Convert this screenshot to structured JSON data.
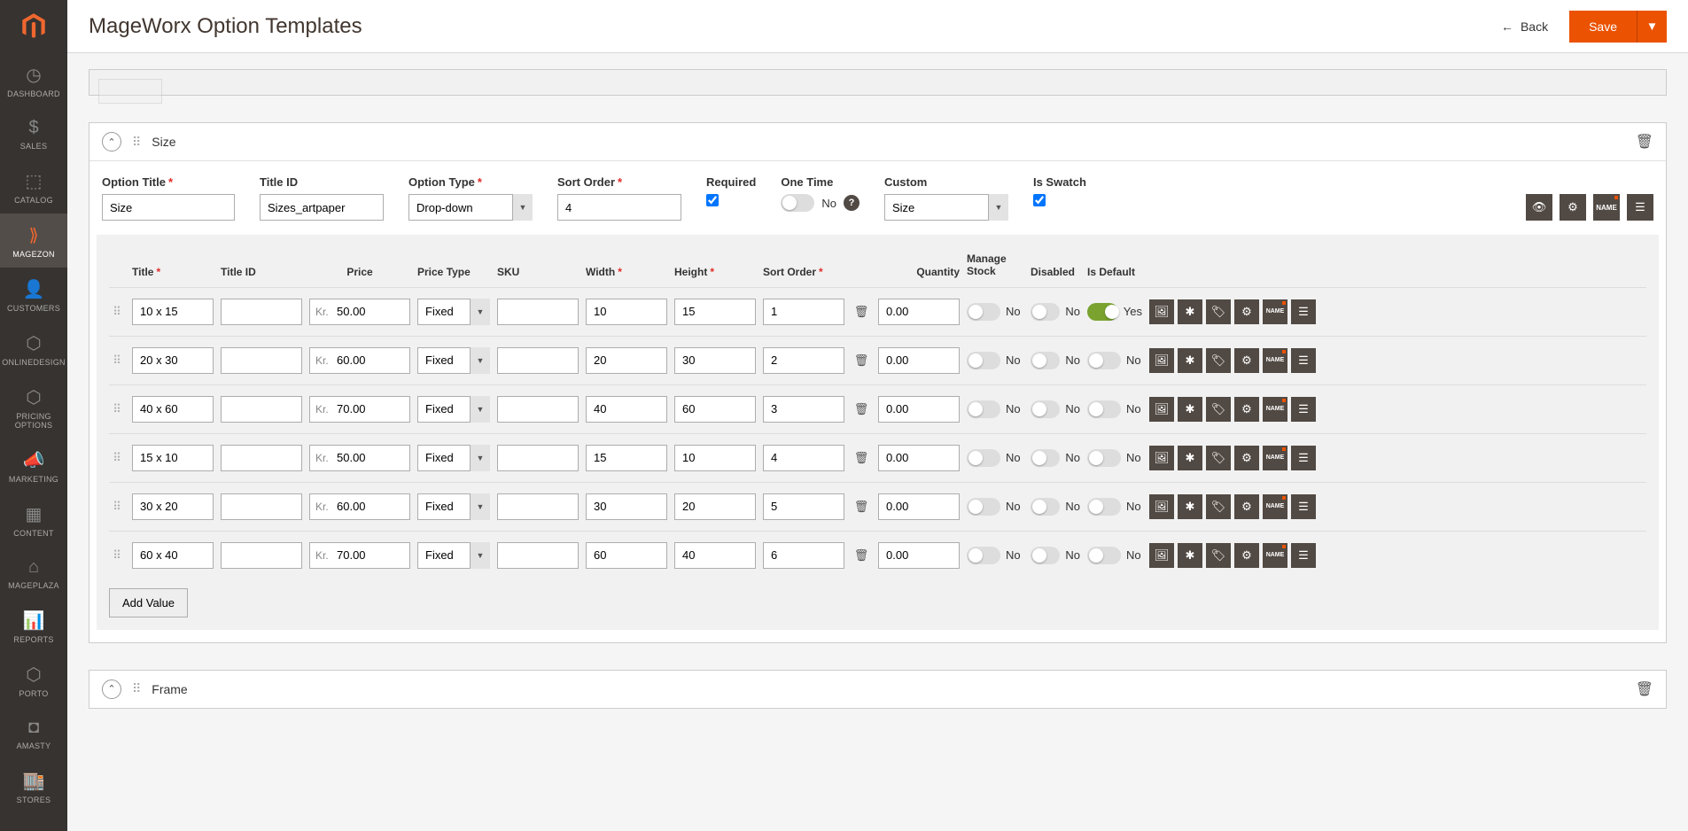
{
  "sidebar": {
    "items": [
      {
        "label": "Dashboard",
        "icon": "dashboard"
      },
      {
        "label": "Sales",
        "icon": "dollar"
      },
      {
        "label": "Catalog",
        "icon": "box"
      },
      {
        "label": "Magezon",
        "icon": "magezon"
      },
      {
        "label": "Customers",
        "icon": "person"
      },
      {
        "label": "OnlineDesign",
        "icon": "hex"
      },
      {
        "label": "Pricing Options",
        "icon": "hex"
      },
      {
        "label": "Marketing",
        "icon": "megaphone"
      },
      {
        "label": "Content",
        "icon": "layout"
      },
      {
        "label": "Mageplaza",
        "icon": "roof"
      },
      {
        "label": "Reports",
        "icon": "bars"
      },
      {
        "label": "Porto",
        "icon": "hex"
      },
      {
        "label": "Amasty",
        "icon": "amasty"
      },
      {
        "label": "Stores",
        "icon": "store"
      }
    ],
    "activeIndex": "3"
  },
  "header": {
    "title": "MageWorx Option Templates",
    "back": "Back",
    "save": "Save"
  },
  "optionPanel": {
    "title": "Size",
    "fields": {
      "optionTitle": {
        "label": "Option Title",
        "value": "Size"
      },
      "titleId": {
        "label": "Title ID",
        "value": "Sizes_artpaper"
      },
      "optionType": {
        "label": "Option Type",
        "value": "Drop-down"
      },
      "sortOrder": {
        "label": "Sort Order",
        "value": "4"
      },
      "required": {
        "label": "Required",
        "checked": "true"
      },
      "oneTime": {
        "label": "One Time",
        "value": "No"
      },
      "custom": {
        "label": "Custom",
        "value": "Size"
      },
      "isSwatch": {
        "label": "Is Swatch",
        "checked": "true"
      }
    },
    "columns": {
      "title": "Title",
      "titleId": "Title ID",
      "price": "Price",
      "priceType": "Price Type",
      "sku": "SKU",
      "width": "Width",
      "height": "Height",
      "sortOrder": "Sort Order",
      "quantity": "Quantity",
      "manageStock": "Manage Stock",
      "disabled": "Disabled",
      "isDefault": "Is Default"
    },
    "currency": "Kr.",
    "toggleText": {
      "no": "No",
      "yes": "Yes"
    },
    "rows": [
      {
        "title": "10 x 15",
        "titleId": "",
        "price": "50.00",
        "ptype": "Fixed",
        "sku": "",
        "width": "10",
        "height": "15",
        "sort": "1",
        "qty": "0.00",
        "mstock": "No",
        "disabled": "No",
        "default": "Yes",
        "defOn": true
      },
      {
        "title": "20 x 30",
        "titleId": "",
        "price": "60.00",
        "ptype": "Fixed",
        "sku": "",
        "width": "20",
        "height": "30",
        "sort": "2",
        "qty": "0.00",
        "mstock": "No",
        "disabled": "No",
        "default": "No",
        "defOn": false
      },
      {
        "title": "40 x 60",
        "titleId": "",
        "price": "70.00",
        "ptype": "Fixed",
        "sku": "",
        "width": "40",
        "height": "60",
        "sort": "3",
        "qty": "0.00",
        "mstock": "No",
        "disabled": "No",
        "default": "No",
        "defOn": false
      },
      {
        "title": "15 x 10",
        "titleId": "",
        "price": "50.00",
        "ptype": "Fixed",
        "sku": "",
        "width": "15",
        "height": "10",
        "sort": "4",
        "qty": "0.00",
        "mstock": "No",
        "disabled": "No",
        "default": "No",
        "defOn": false
      },
      {
        "title": "30 x 20",
        "titleId": "",
        "price": "60.00",
        "ptype": "Fixed",
        "sku": "",
        "width": "30",
        "height": "20",
        "sort": "5",
        "qty": "0.00",
        "mstock": "No",
        "disabled": "No",
        "default": "No",
        "defOn": false
      },
      {
        "title": "60 x 40",
        "titleId": "",
        "price": "70.00",
        "ptype": "Fixed",
        "sku": "",
        "width": "60",
        "height": "40",
        "sort": "6",
        "qty": "0.00",
        "mstock": "No",
        "disabled": "No",
        "default": "No",
        "defOn": false
      }
    ],
    "addValue": "Add Value"
  },
  "framePanel": {
    "title": "Frame"
  }
}
